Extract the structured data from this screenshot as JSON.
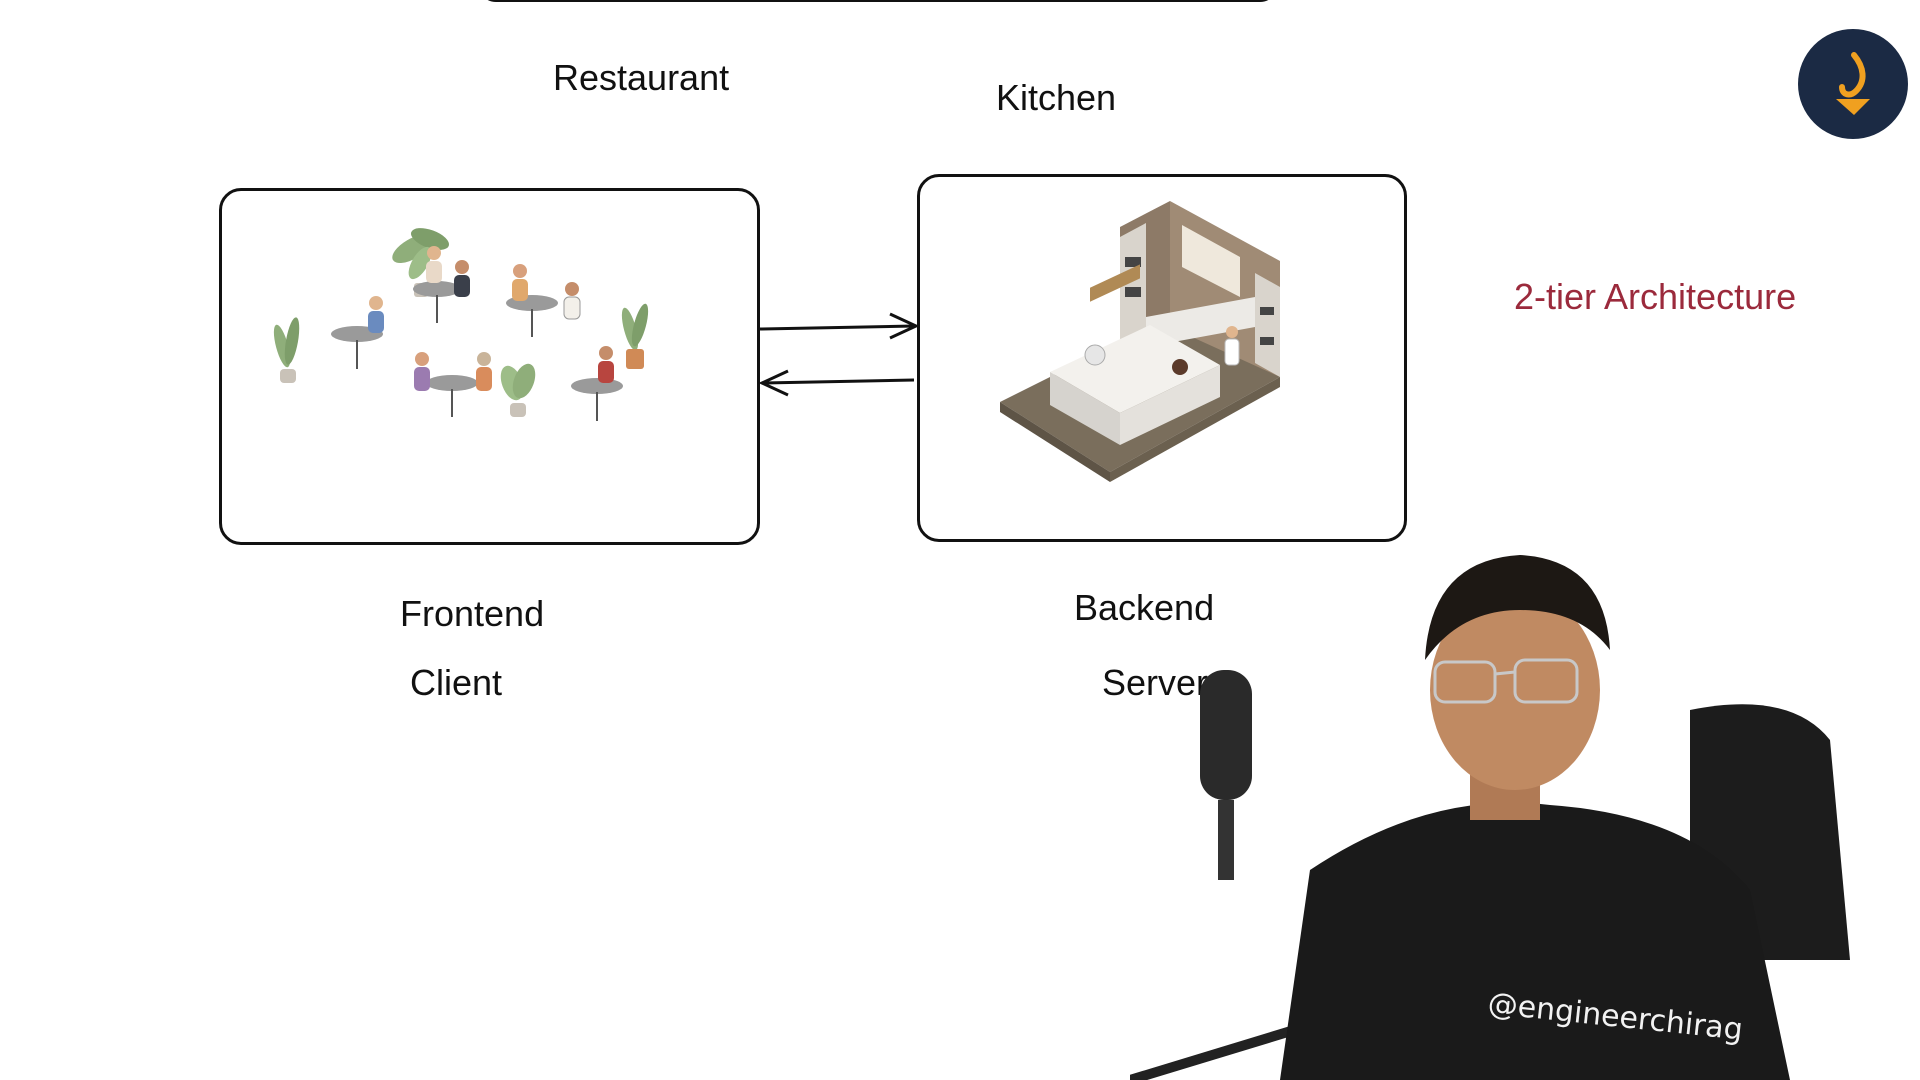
{
  "labels": {
    "restaurant": "Restaurant",
    "kitchen": "Kitchen",
    "frontend": "Frontend",
    "client": "Client",
    "backend": "Backend",
    "server": "Server",
    "architecture": "2-tier Architecture"
  },
  "presenter": {
    "handle": "@engineerchirag"
  },
  "colors": {
    "accent_title": "#9b2a3c",
    "logo_bg": "#1b2a44",
    "logo_mark": "#f0a020",
    "stroke": "#111111"
  },
  "icons": {
    "restaurant_illustration": "restaurant-dining-illustration",
    "kitchen_illustration": "isometric-kitchen-illustration",
    "logo": "channel-logo-icon"
  }
}
